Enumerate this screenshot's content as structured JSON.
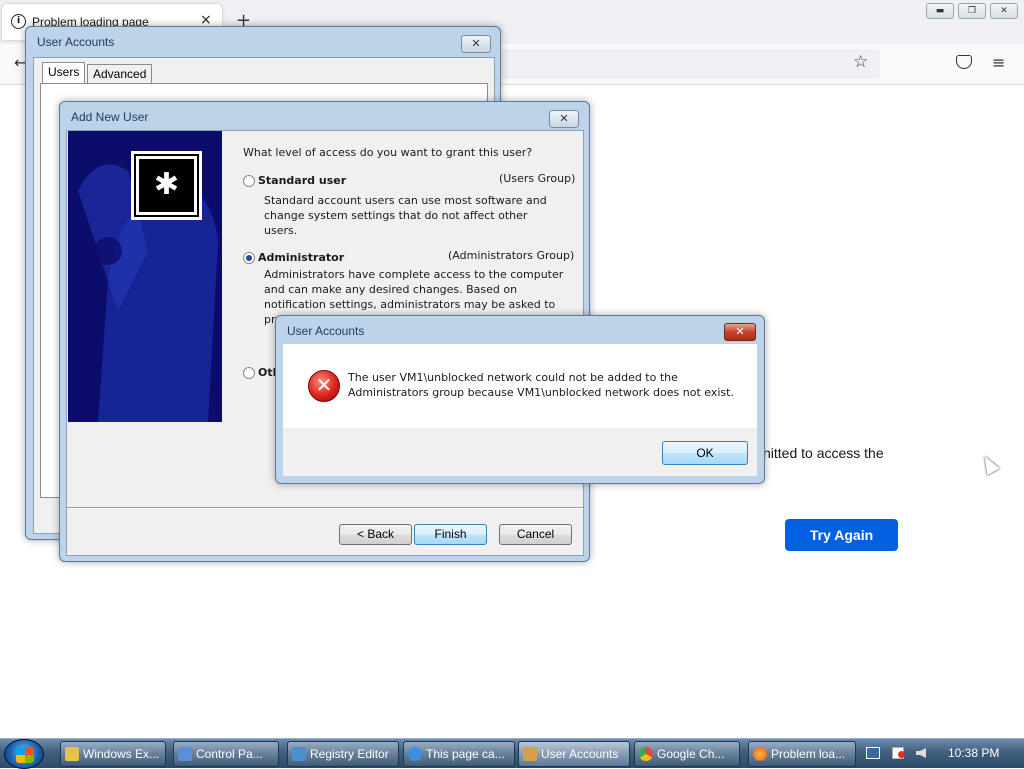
{
  "firefox": {
    "tab_title": "Problem loading page",
    "info_glyph": "i",
    "close_glyph": "×",
    "newtab_glyph": "+",
    "min_glyph": "▬",
    "restore_glyph": "❐",
    "close_window_glyph": "✕",
    "back_glyph": "←",
    "star_glyph": "☆",
    "menu_glyph": "≡",
    "error_text_fragment": "nitted to access the",
    "try_again_label": "Try Again"
  },
  "user_accounts_window": {
    "title": "User Accounts",
    "close_glyph": "✕",
    "tabs": [
      "Users",
      "Advanced"
    ]
  },
  "add_new_user": {
    "title": "Add New User",
    "close_glyph": "✕",
    "key_glyph": "✱",
    "question": "What level of access do you want to grant this user?",
    "options": [
      {
        "label": "Standard user",
        "group": "(Users Group)",
        "desc": "Standard account users can use most software and change system settings that do not affect other users.",
        "selected": false
      },
      {
        "label": "Administrator",
        "group": "(Administrators Group)",
        "desc": "Administrators have complete access to the computer and can make any desired changes. Based on notification settings, administrators may be asked to provide their pa... aff...",
        "selected": true
      },
      {
        "label": "Oth",
        "group": "",
        "desc": "",
        "selected": false
      }
    ],
    "buttons": {
      "back": "< Back",
      "finish": "Finish",
      "cancel": "Cancel"
    }
  },
  "error_dialog": {
    "title": "User Accounts",
    "close_glyph": "✕",
    "icon_glyph": "✕",
    "message_line1": "The user VM1\\unblocked network could not be added to the",
    "message_line2": "Administrators group because VM1\\unblocked network does not exist.",
    "ok_label": "OK"
  },
  "taskbar": {
    "items": [
      {
        "label": "Windows Ex...",
        "icon_color": "#e8c34a"
      },
      {
        "label": "Control Pa...",
        "icon_color": "#5b8fd6"
      },
      {
        "label": "Registry Editor",
        "icon_color": "#4a8fcf"
      },
      {
        "label": "This page ca...",
        "icon_color": "#3f8fe0"
      },
      {
        "label": "User Accounts",
        "icon_color": "#d9a04a"
      },
      {
        "label": "Google Ch...",
        "icon_color": "#e04a3a"
      },
      {
        "label": "Problem loa...",
        "icon_color": "#ff7a1a"
      }
    ],
    "clock": "10:38 PM",
    "tray_icons": [
      "network-icon",
      "flag-icon",
      "speaker-icon"
    ]
  }
}
